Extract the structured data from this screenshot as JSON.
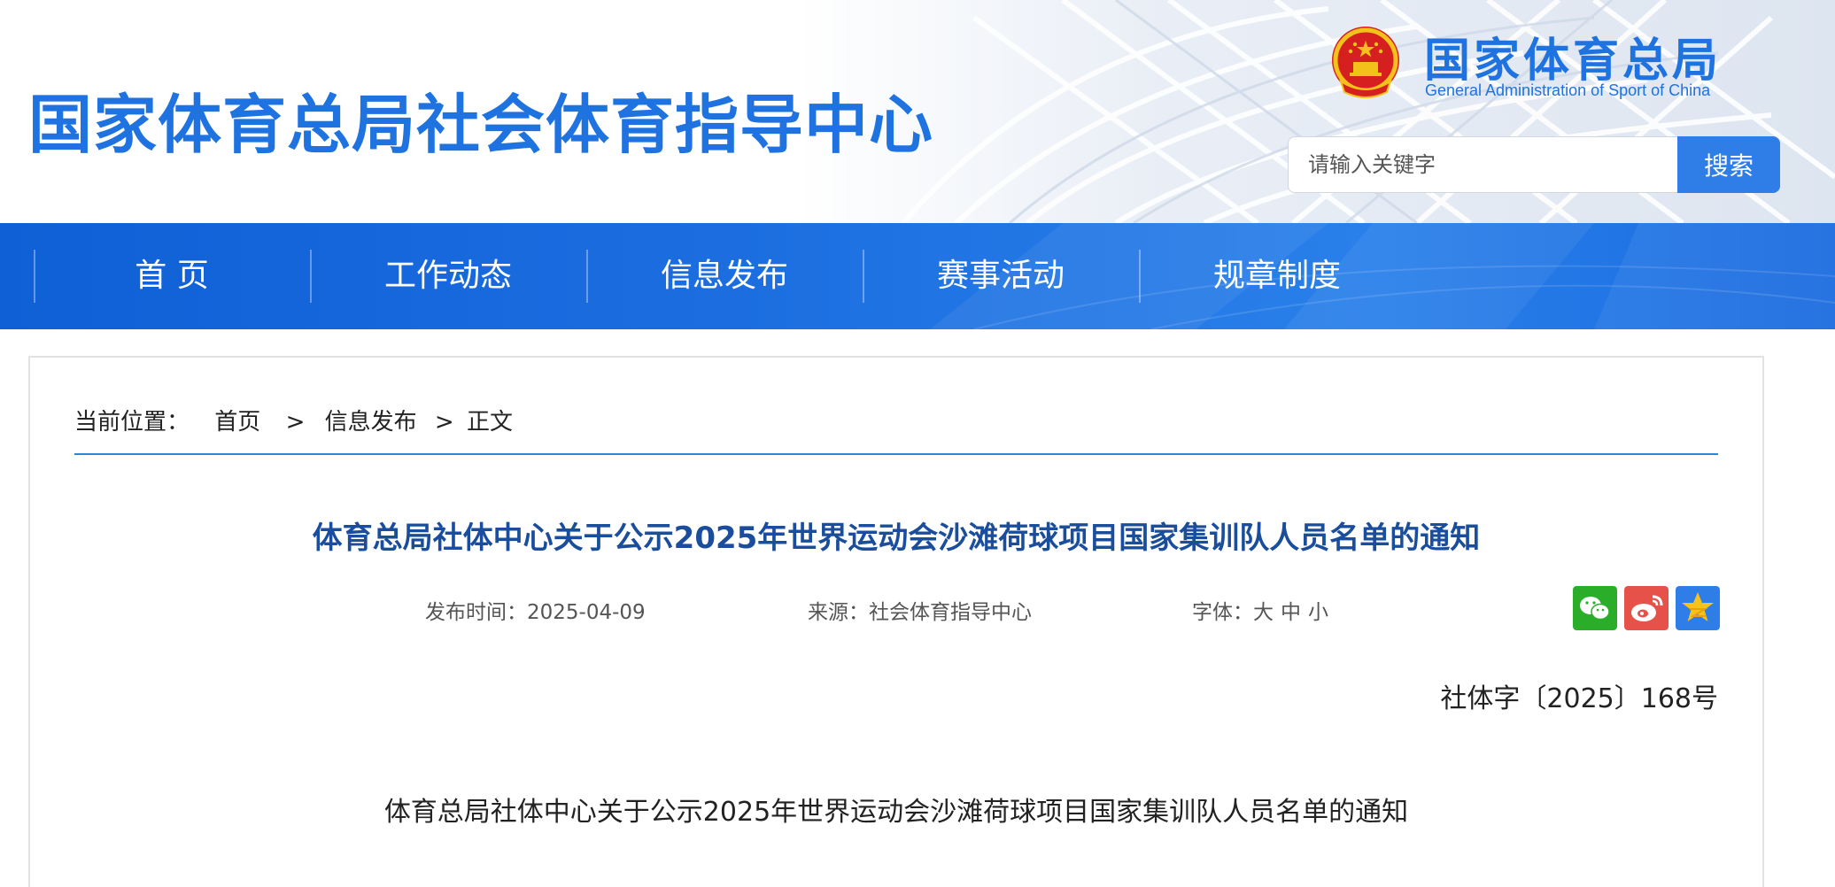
{
  "header": {
    "site_title": "国家体育总局社会体育指导中心",
    "org_name_cn": "国家体育总局",
    "org_name_en": "General Administration of Sport of China",
    "search_placeholder": "请输入关键字",
    "search_button": "搜索",
    "icons": {
      "emblem": "national-emblem-icon"
    }
  },
  "nav": {
    "items": [
      {
        "label": "首 页"
      },
      {
        "label": "工作动态"
      },
      {
        "label": "信息发布"
      },
      {
        "label": "赛事活动"
      },
      {
        "label": "规章制度"
      }
    ]
  },
  "breadcrumb": {
    "prefix": "当前位置：",
    "home": "首页",
    "sep1": ">",
    "section": "信息发布",
    "sep2": ">",
    "current": "正文"
  },
  "article": {
    "title": "体育总局社体中心关于公示2025年世界运动会沙滩荷球项目国家集训队人员名单的通知",
    "publish_label": "发布时间：",
    "publish_date": "2025-04-09",
    "source_label": "来源：",
    "source": "社会体育指导中心",
    "font_label": "字体：",
    "font_large": "大",
    "font_medium": "中",
    "font_small": "小",
    "doc_number": "社体字〔2025〕168号",
    "body_title": "体育总局社体中心关于公示2025年世界运动会沙滩荷球项目国家集训队人员名单的通知"
  },
  "share": {
    "icons": [
      "wechat-icon",
      "weibo-icon",
      "qzone-icon"
    ]
  },
  "colors": {
    "brand_blue": "#1e73e0",
    "nav_blue": "#1c6ee0",
    "title_blue": "#1a4e9c",
    "wechat_green": "#2aae2a",
    "weibo_red": "#e6524a",
    "qzone_blue": "#2f7de6"
  }
}
